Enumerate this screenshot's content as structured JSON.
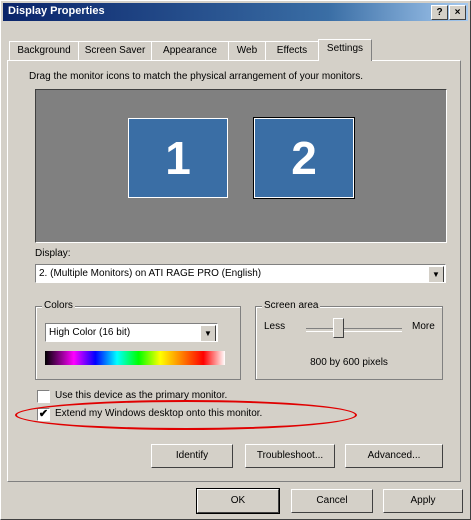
{
  "window": {
    "title": "Display Properties",
    "help_btn": "?",
    "close_btn": "×"
  },
  "tabs": [
    {
      "label": "Background"
    },
    {
      "label": "Screen Saver"
    },
    {
      "label": "Appearance"
    },
    {
      "label": "Web"
    },
    {
      "label": "Effects"
    },
    {
      "label": "Settings",
      "active": true
    }
  ],
  "settings": {
    "instruction": "Drag the monitor icons to match the physical arrangement of your monitors.",
    "monitors": [
      {
        "number": "1"
      },
      {
        "number": "2",
        "selected": true
      }
    ],
    "display_label": "Display:",
    "display_value": "2. (Multiple Monitors) on ATI RAGE PRO (English)",
    "colors_label": "Colors",
    "colors_value": "High Color (16 bit)",
    "screen_area_label": "Screen area",
    "less_label": "Less",
    "more_label": "More",
    "slider_position": 0.33,
    "resolution": "800 by 600 pixels",
    "primary_checkbox": {
      "label": "Use this device as the primary monitor.",
      "checked": false
    },
    "extend_checkbox": {
      "label": "Extend my Windows desktop onto this monitor.",
      "checked": true
    },
    "identify_btn": "Identify",
    "troubleshoot_btn": "Troubleshoot...",
    "advanced_btn": "Advanced..."
  },
  "footer": {
    "ok_btn": "OK",
    "cancel_btn": "Cancel",
    "apply_btn": "Apply"
  },
  "annotation_color": "#e00000"
}
